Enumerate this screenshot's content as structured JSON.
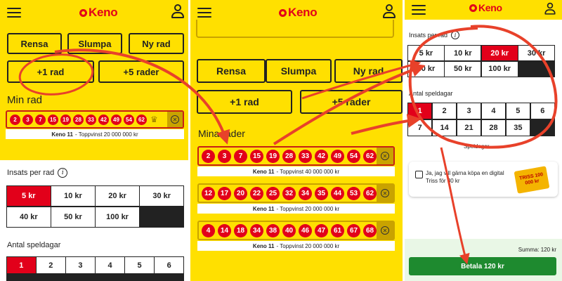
{
  "colors": {
    "brand_yellow": "#ffe000",
    "brand_red": "#e2001a",
    "pay_green": "#1e8a2f",
    "annotation_red": "#e8412a"
  },
  "app": {
    "logo_text": "Keno"
  },
  "panel1": {
    "buttons": {
      "rensa": "Rensa",
      "slumpa": "Slumpa",
      "ny_rad": "Ny rad",
      "plus1": "+1 rad",
      "plus5": "+5 rader"
    },
    "section_title": "Min rad",
    "row": {
      "numbers": [
        "2",
        "3",
        "7",
        "15",
        "19",
        "28",
        "33",
        "42",
        "49",
        "54",
        "62"
      ],
      "game": "Keno 11",
      "prize": "- Toppvinst 20 000 000 kr"
    },
    "stake": {
      "label": "Insats per rad",
      "info": "i",
      "options": [
        "5 kr",
        "10 kr",
        "20 kr",
        "30 kr",
        "40 kr",
        "50 kr",
        "100 kr"
      ],
      "selected": "5 kr"
    },
    "days": {
      "label": "Antal speldagar",
      "options": [
        "1",
        "2",
        "3",
        "4",
        "5",
        "6"
      ],
      "selected": "1"
    }
  },
  "panel2": {
    "buttons": {
      "rensa": "Rensa",
      "slumpa": "Slumpa",
      "ny_rad": "Ny rad",
      "plus1": "+1 rad",
      "plus5": "+5 rader"
    },
    "section_title": "Mina rader",
    "rows": [
      {
        "numbers": [
          "2",
          "3",
          "7",
          "15",
          "19",
          "28",
          "33",
          "42",
          "49",
          "54",
          "62"
        ],
        "game": "Keno 11",
        "prize": "- Toppvinst 40 000 000 kr"
      },
      {
        "numbers": [
          "12",
          "17",
          "20",
          "22",
          "25",
          "32",
          "34",
          "35",
          "44",
          "53",
          "62"
        ],
        "game": "Keno 11",
        "prize": "- Toppvinst 20 000 000 kr"
      },
      {
        "numbers": [
          "4",
          "14",
          "18",
          "34",
          "38",
          "40",
          "46",
          "47",
          "61",
          "67",
          "68"
        ],
        "game": "Keno 11",
        "prize": "- Toppvinst 20 000 000 kr"
      }
    ]
  },
  "panel3": {
    "stake": {
      "label": "Insats per rad",
      "info": "i",
      "options": [
        "5 kr",
        "10 kr",
        "20 kr",
        "30 kr",
        "40 kr",
        "50 kr",
        "100 kr"
      ],
      "selected": "20 kr"
    },
    "days": {
      "label": "Antal speldagar",
      "options": [
        "1",
        "2",
        "3",
        "4",
        "5",
        "6",
        "7",
        "14",
        "21",
        "28",
        "35"
      ],
      "selected": "1"
    },
    "days_caption": "Speldagar",
    "triss": {
      "text": "Ja, jag vill gärna köpa en digital Triss för 30 kr",
      "image_text": "TRISS 100 000 kr"
    },
    "summa": "Summa: 120 kr",
    "pay_label": "Betala 120 kr"
  }
}
